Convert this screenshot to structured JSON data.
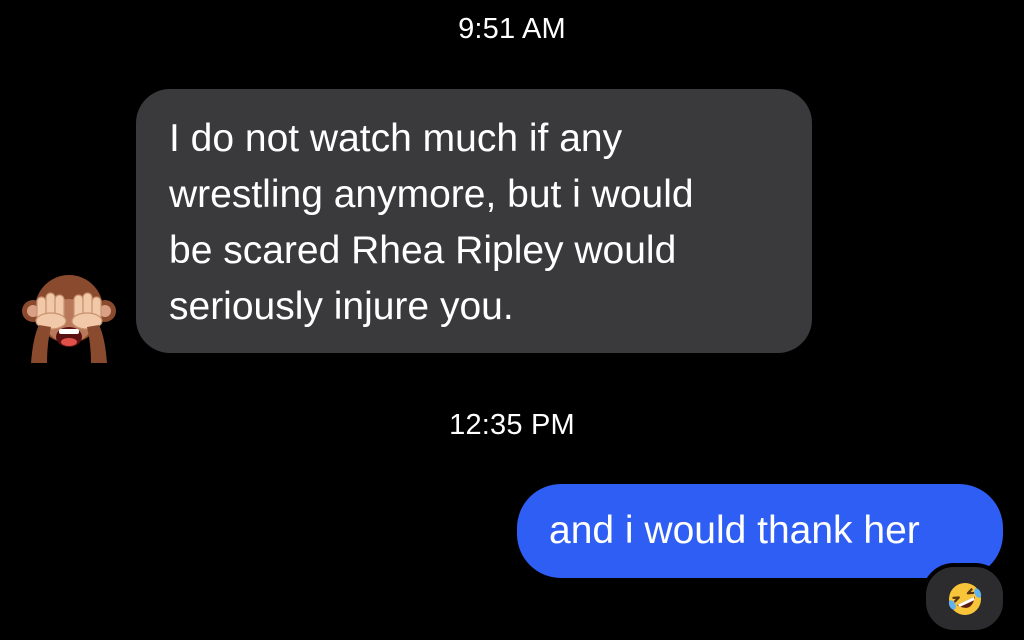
{
  "conversation": {
    "timestamps": [
      "9:51 AM",
      "12:35 PM"
    ],
    "messages": [
      {
        "direction": "received",
        "text": "I do not watch much if any\nwrestling anymore, but i would\nbe scared Rhea Ripley would\nseriously injure you.",
        "avatar_icon": "see-no-evil-monkey-icon"
      },
      {
        "direction": "sent",
        "text": "and i would thank her",
        "reaction_icon": "rolling-on-floor-laughing-icon"
      }
    ]
  },
  "colors": {
    "background": "#000000",
    "received_bubble": "#3a3a3c",
    "sent_bubble": "#2f5ef5",
    "text": "#ffffff"
  }
}
